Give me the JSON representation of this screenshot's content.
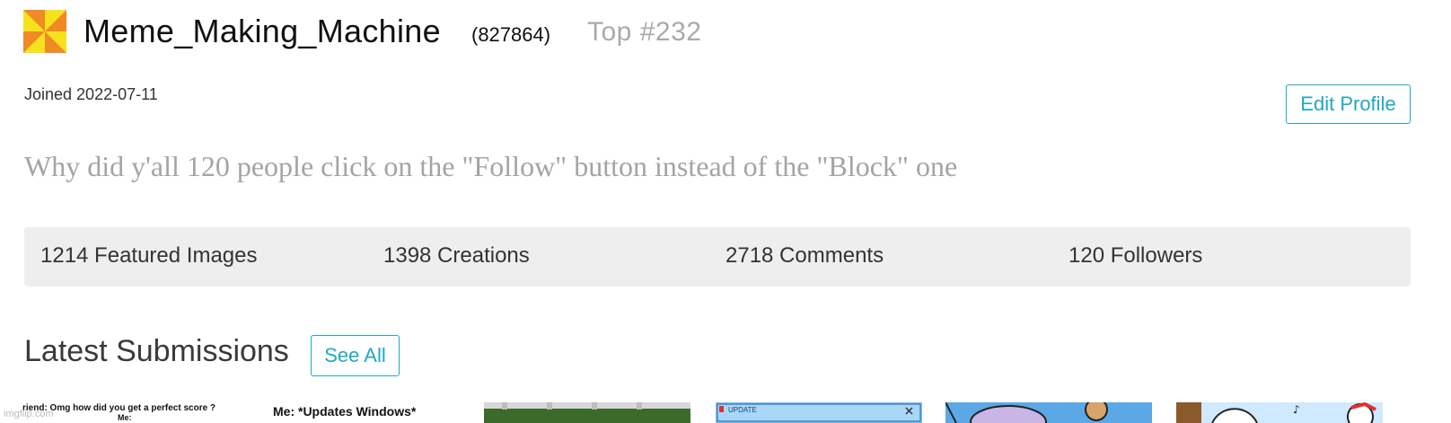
{
  "profile": {
    "username": "Meme_Making_Machine",
    "points": "(827864)",
    "rank": "Top #232",
    "joined": "Joined 2022-07-11",
    "edit_profile_label": "Edit Profile",
    "bio": "Why did y'all 120 people click on the \"Follow\" button instead of the \"Block\" one",
    "avatar_colors": {
      "background": "#f6e21c",
      "accent": "#f08a24"
    }
  },
  "stats": [
    {
      "label": "1214 Featured Images"
    },
    {
      "label": "1398 Creations"
    },
    {
      "label": "2718 Comments"
    },
    {
      "label": "120 Followers"
    }
  ],
  "latest": {
    "title": "Latest Submissions",
    "see_all_label": "See All"
  },
  "thumbnails": [
    {
      "caption_line1": "riend: Omg how did you get a perfect score ?",
      "caption_line2": "Me:"
    },
    {
      "caption_line1": "Me: *Updates Windows*"
    },
    {
      "icon": "grass-image-icon"
    },
    {
      "caption_line1": "UPDATE",
      "icon": "update-window-icon"
    },
    {
      "icon": "cartoon-image-icon"
    },
    {
      "icon": "cartoon-image-icon"
    }
  ],
  "watermark": "imgflip.com",
  "colors": {
    "accent": "#20a8c3",
    "muted": "#a4a4a4",
    "stats_bg": "#eeeeee"
  }
}
